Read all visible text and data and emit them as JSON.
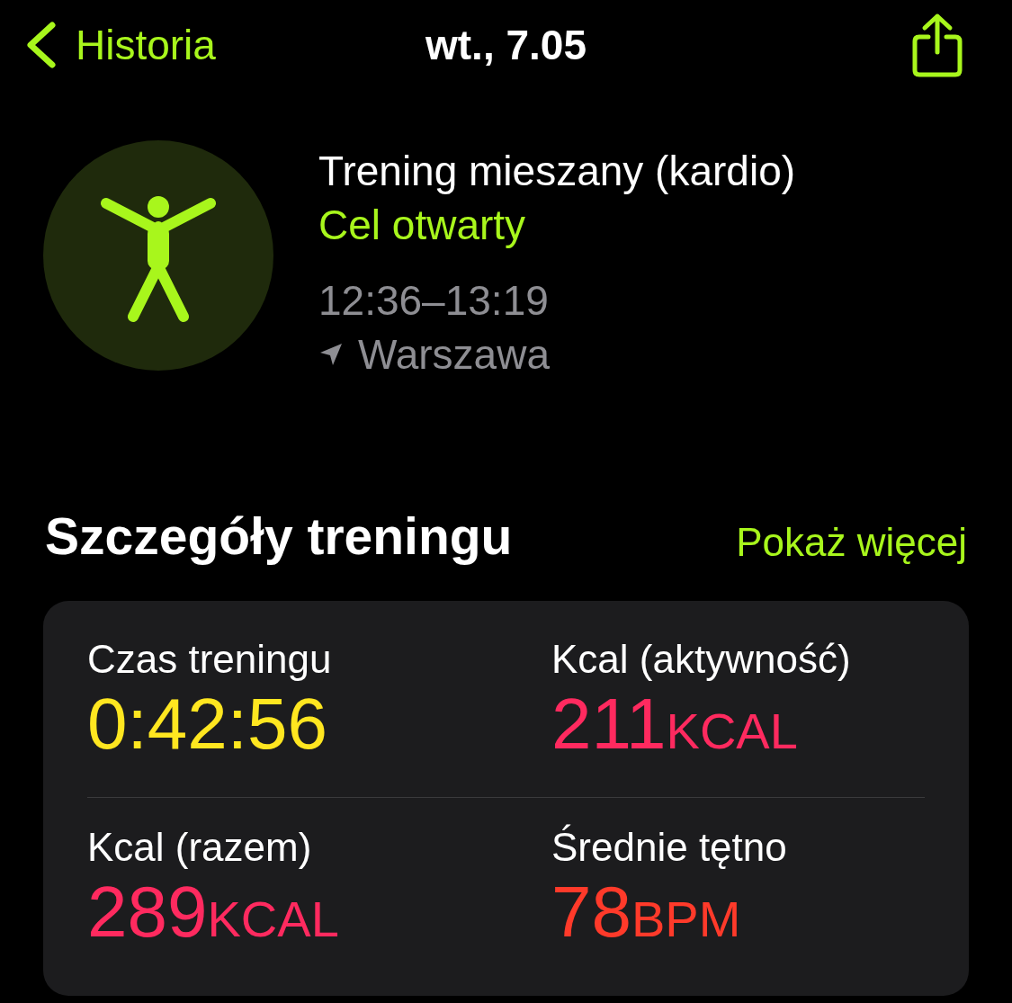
{
  "nav": {
    "back_label": "Historia",
    "title": "wt., 7.05"
  },
  "workout": {
    "name": "Trening mieszany (kardio)",
    "goal": "Cel otwarty",
    "time": "12:36–13:19",
    "location": "Warszawa"
  },
  "section": {
    "title": "Szczegóły treningu",
    "link": "Pokaż więcej"
  },
  "metrics": [
    {
      "label": "Czas treningu",
      "value": "0:42:56",
      "color": "#ffe620"
    },
    {
      "label": "Kcal (aktywność)",
      "value": "211",
      "unit": "KCAL",
      "color": "#ff2a5f"
    },
    {
      "label": "Kcal (razem)",
      "value": "289",
      "unit": "KCAL",
      "color": "#ff2a5f"
    },
    {
      "label": "Średnie tętno",
      "value": "78",
      "unit": "BPM",
      "color": "#ff3a2a"
    }
  ]
}
